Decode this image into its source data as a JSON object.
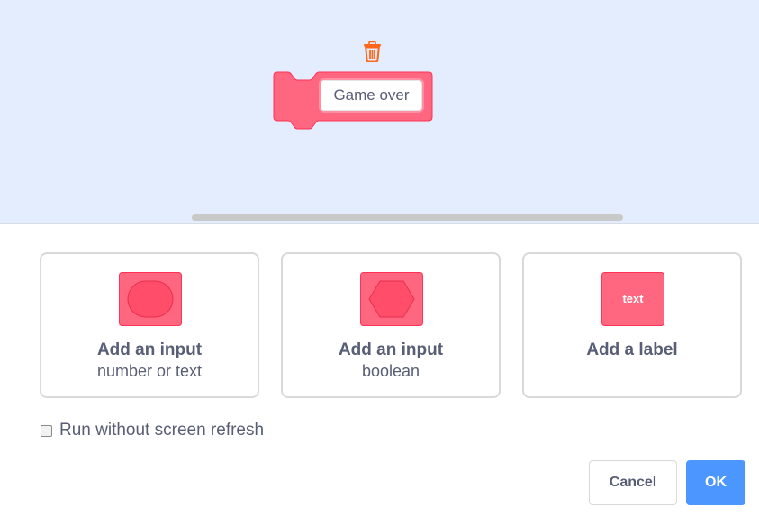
{
  "preview": {
    "block_text": "Game over",
    "trash_icon": "trash-icon"
  },
  "options": [
    {
      "title": "Add an input",
      "subtitle": "number or text",
      "icon": "number-text-input-icon"
    },
    {
      "title": "Add an input",
      "subtitle": "boolean",
      "icon": "boolean-input-icon"
    },
    {
      "title": "Add a label",
      "subtitle": "",
      "icon": "label-icon",
      "icon_text": "text"
    }
  ],
  "run_without_refresh": {
    "label": "Run without screen refresh",
    "checked": false
  },
  "buttons": {
    "cancel": "Cancel",
    "ok": "OK"
  },
  "colors": {
    "block_fill": "#ff6680",
    "block_stroke": "#ff3355",
    "accent": "#4c97ff",
    "preview_bg": "#e3edfd",
    "text": "#575e75",
    "trash": "#ff661a"
  }
}
